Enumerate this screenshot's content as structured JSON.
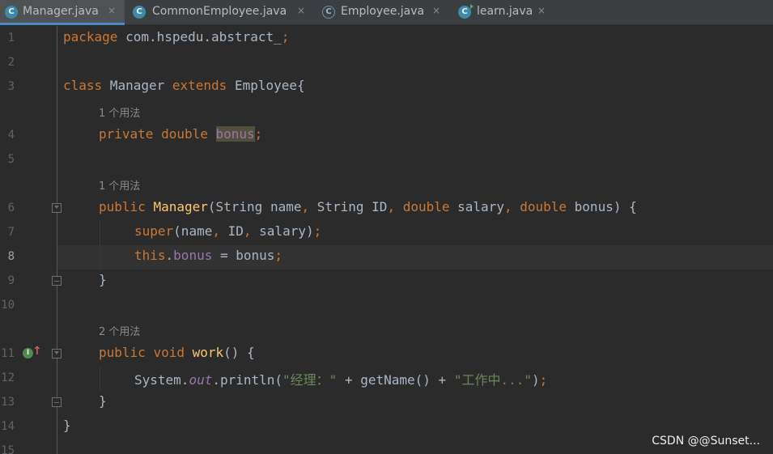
{
  "tabs": [
    {
      "icon": "class-icon",
      "badge": "C",
      "label": "Manager.java",
      "close": "×",
      "active": true
    },
    {
      "icon": "class-icon",
      "badge": "C",
      "label": "CommonEmployee.java",
      "close": "×",
      "active": false
    },
    {
      "icon": "abstract-class-icon",
      "badge": "C",
      "label": "Employee.java",
      "close": "×",
      "active": false
    },
    {
      "icon": "runnable-class-icon",
      "badge": "C",
      "label": "learn.java",
      "close": "×",
      "active": false
    }
  ],
  "editor": {
    "current_line": 8,
    "line_numbers": [
      "1",
      "2",
      "3",
      "4",
      "5",
      "6",
      "7",
      "8",
      "9",
      "10",
      "11",
      "12",
      "13",
      "14",
      "15"
    ],
    "hints": {
      "field_usage": "1 个用法",
      "ctor_usage": "1 个用法",
      "work_usage": "2 个用法"
    },
    "code": {
      "l1": {
        "kw": "package",
        "rest": " com.hspedu.abstract_",
        "semi": ";"
      },
      "l3": {
        "kw1": "class",
        "name": " Manager ",
        "kw2": "extends",
        "rest": " Employee{"
      },
      "l4": {
        "kw1": "private",
        "kw2": " double ",
        "field": "bonus",
        "semi": ";"
      },
      "l6": {
        "kw": "public ",
        "fn": "Manager",
        "p1": "(String name",
        "c1": ",",
        "p2": " String ID",
        "c2": ",",
        "kw2": " double",
        "p3": " salary",
        "c3": ",",
        "kw3": " double",
        "p4": " bonus) {"
      },
      "l7": {
        "kw": "super",
        "p1": "(name",
        "c1": ",",
        "p2": " ID",
        "c2": ",",
        "p3": " salary)",
        "semi": ";"
      },
      "l8": {
        "kw": "this",
        "dot": ".",
        "field": "bonus",
        "rest": " = bonus",
        "semi": ";"
      },
      "l9": "}",
      "l11": {
        "kw": "public ",
        "kw2": "void ",
        "fn": "work",
        "rest": "() {"
      },
      "l12": {
        "p1": "System.",
        "static": "out",
        "p2": ".println(",
        "str1": "\"经理：\"",
        "p3": " + getName() + ",
        "str2": "\"工作中...\"",
        "p4": ")",
        "semi": ";"
      },
      "l13": "}",
      "l14": "}"
    },
    "gutter_icons": {
      "impl_badge": "I",
      "override_arrow": "↑"
    }
  },
  "watermark": "CSDN @@Sunset...",
  "colors": {
    "background": "#2b2b2b",
    "keyword": "#cc7832",
    "function": "#ffc66d",
    "field": "#9876aa",
    "string": "#6a8759",
    "text": "#a9b7c6",
    "tab_active_underline": "#4a88c7"
  }
}
